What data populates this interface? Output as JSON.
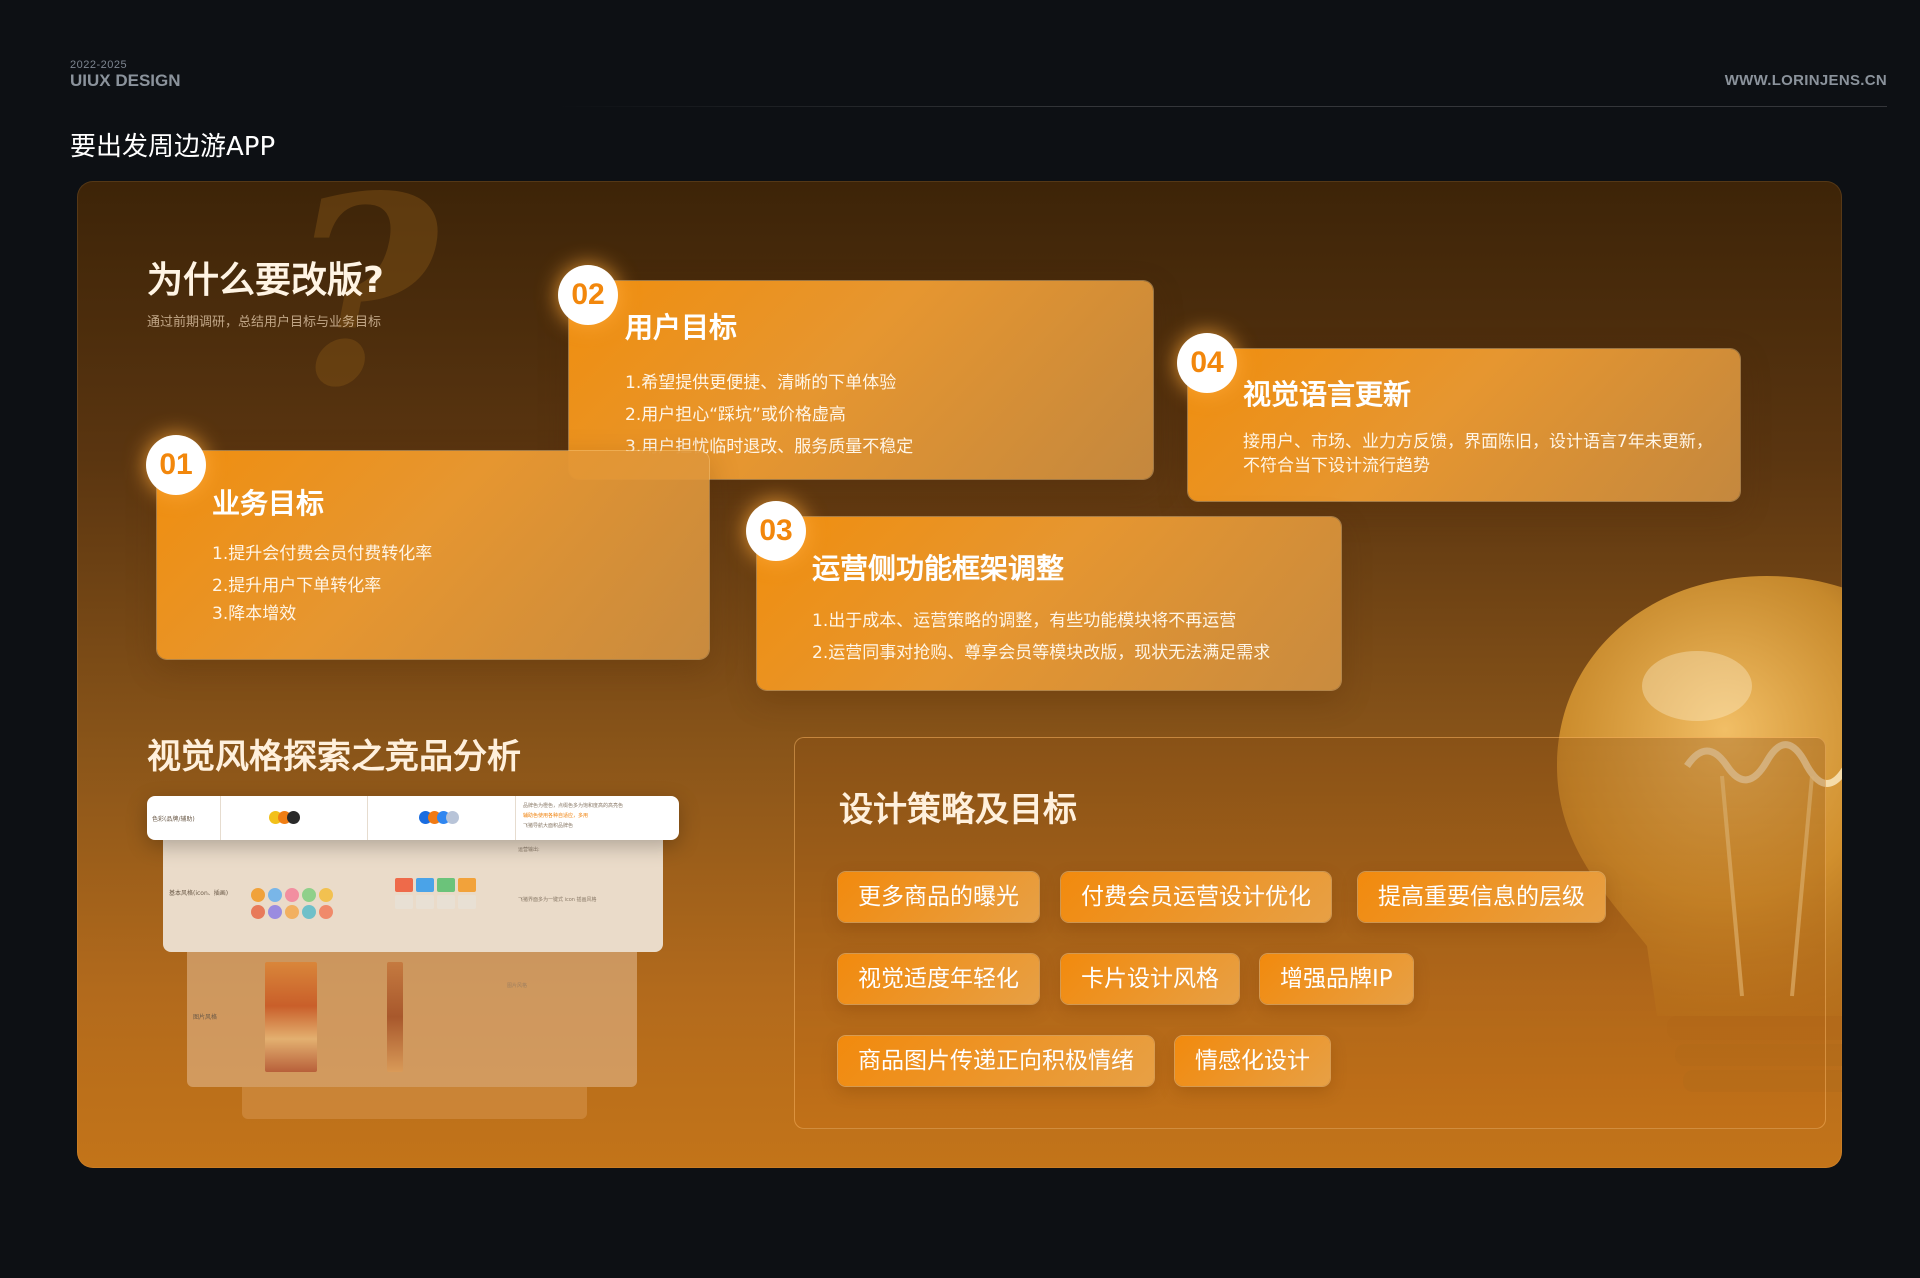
{
  "header": {
    "year": "2022-2025",
    "brand": "UIUX DESIGN",
    "site": "WWW.LORINJENS.CN",
    "page_title": "要出发周边游APP"
  },
  "why": {
    "title": "为什么要改版?",
    "subtitle": "通过前期调研，总结用户目标与业务目标"
  },
  "cards": [
    {
      "num": "01",
      "title": "业务目标",
      "lines": [
        "1.提升会付费会员付费转化率",
        "2.提升用户下单转化率",
        "3.降本增效"
      ]
    },
    {
      "num": "02",
      "title": "用户目标",
      "lines": [
        "1.希望提供更便捷、清晰的下单体验",
        "2.用户担心“踩坑”或价格虚高",
        "3.用户担忧临时退改、服务质量不稳定"
      ]
    },
    {
      "num": "03",
      "title": "运营侧功能框架调整",
      "lines": [
        "1.出于成本、运营策略的调整，有些功能模块将不再运营",
        "2.运营同事对抢购、尊享会员等模块改版，现状无法满足需求"
      ]
    },
    {
      "num": "04",
      "title": "视觉语言更新",
      "paragraph": "接用户、市场、业力方反馈，界面陈旧，设计语言7年未更新，不符合当下设计流行趋势"
    }
  ],
  "competitor": {
    "title": "视觉风格探索之竞品分析",
    "row_labels": [
      "色彩(品牌/辅助)",
      "基本风格(icon、插画)",
      "图片风格"
    ],
    "notes": [
      "品牌色为橙色，点缀色多为饱和度高的高亮色",
      "辅助色使用各种自适应，多用",
      "飞猪导航大面积品牌色",
      "运营输出:",
      "飞猪界面多为一键式 icon 插画风格",
      "图片风格"
    ]
  },
  "strategy": {
    "title": "设计策略及目标",
    "tags": [
      "更多商品的曝光",
      "付费会员运营设计优化",
      "提高重要信息的层级",
      "视觉适度年轻化",
      "卡片设计风格",
      "增强品牌IP",
      "商品图片传递正向积极情绪",
      "情感化设计"
    ]
  },
  "colors": {
    "accent": "#f08e0e",
    "background": "#0d1014",
    "badge_text": "#f2870c"
  }
}
